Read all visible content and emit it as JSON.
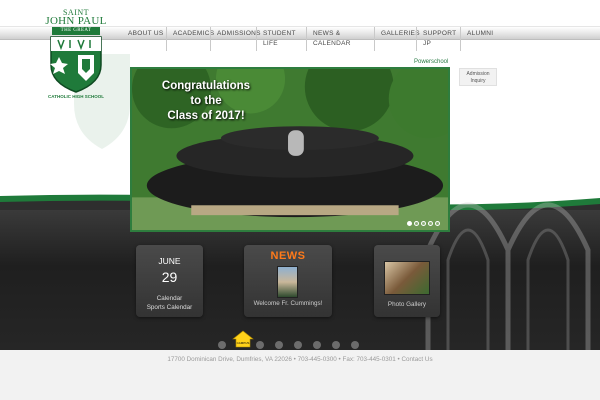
{
  "logo": {
    "saint": "SAINT",
    "name": "JOHN PAUL",
    "the_great": "THE GREAT",
    "school": "CATHOLIC HIGH SCHOOL"
  },
  "nav": {
    "items": [
      "ABOUT US",
      "ACADEMICS",
      "ADMISSIONS",
      "STUDENT LIFE",
      "NEWS & CALENDAR",
      "GALLERIES",
      "SUPPORT JP",
      "ALUMNI"
    ]
  },
  "links": {
    "powerschool": "Powerschool",
    "admission_inquiry": "Admission Inquiry"
  },
  "hero": {
    "headline_line1": "Congratulations",
    "headline_line2": "to the",
    "headline_line3": "Class of 2017!",
    "slide_count": 5,
    "active_slide": 1
  },
  "calendar_tile": {
    "month": "JUNE",
    "day": "29",
    "link1": "Calendar",
    "link2": "Sports Calendar"
  },
  "news_tile": {
    "heading": "NEWS",
    "caption": "Welcome Fr. Cummings!"
  },
  "photo_tile": {
    "caption": "Photo Gallery"
  },
  "bubbles": {
    "house_label": "CAMPUS",
    "count": 7
  },
  "footer": {
    "address": "17700 Dominican Drive, Dumfries, VA 22026",
    "phone": "703-445-0300",
    "fax": "Fax: 703-445-0301",
    "contact": "Contact Us"
  },
  "colors": {
    "brand_green": "#1f7a3a",
    "news_orange": "#ff7a1a",
    "dark_bg": "#262626"
  }
}
